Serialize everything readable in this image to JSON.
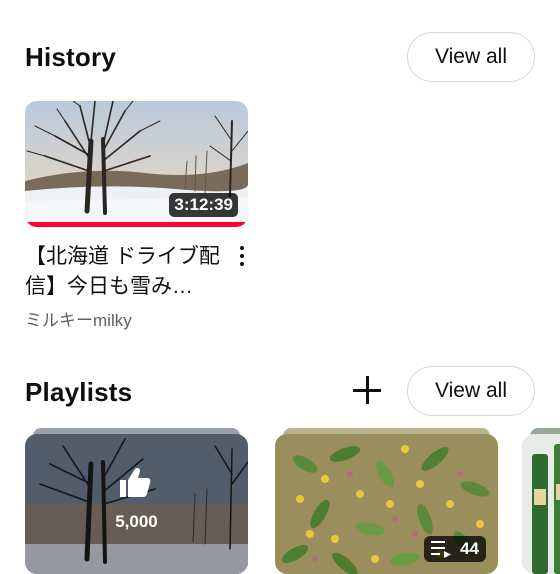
{
  "history": {
    "title": "History",
    "view_all": "View all",
    "video": {
      "duration": "3:12:39",
      "title": "【北海道 ドライブ配信】今日も雪み…",
      "channel": "ミルキーmilky",
      "watched_fraction": 1.0
    }
  },
  "playlists": {
    "title": "Playlists",
    "view_all": "View all",
    "add_icon": "plus-icon",
    "items": [
      {
        "kind": "liked",
        "icon": "thumbs-up-icon",
        "count": "5,000"
      },
      {
        "kind": "playlist",
        "icon": "playlist-icon",
        "count": "44"
      },
      {
        "kind": "playlist-partial"
      }
    ]
  },
  "colors": {
    "progress": "#ff0033",
    "text_primary": "#0f0f0f",
    "text_secondary": "#606060"
  }
}
